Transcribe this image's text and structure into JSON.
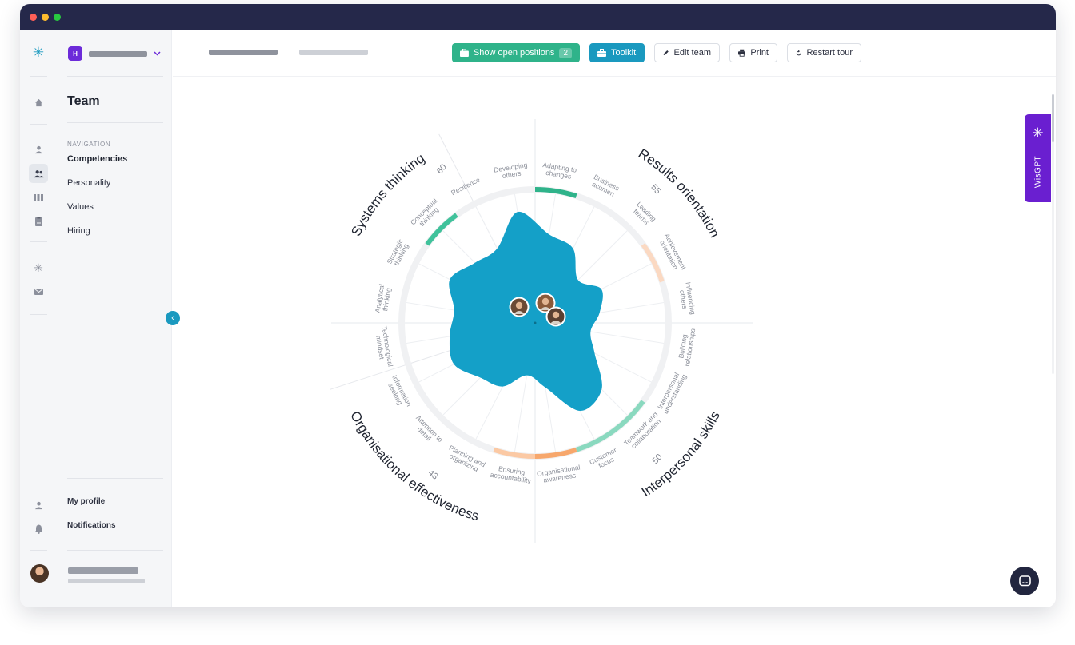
{
  "window": {
    "controls": [
      "close",
      "minimize",
      "maximize"
    ],
    "colors": {
      "close": "#ff5f57",
      "minimize": "#febc2e",
      "maximize": "#28c840"
    }
  },
  "rail": {
    "icons": [
      "snowflake-logo-icon",
      "home-icon",
      "person-icon",
      "team-icon",
      "columns-icon",
      "clipboard-icon",
      "snowflake-icon",
      "mail-icon",
      "person-icon",
      "bell-icon"
    ]
  },
  "sidebar": {
    "workspace_initial": "H",
    "title": "Team",
    "nav_caption": "NAVIGATION",
    "items": [
      {
        "label": "Competencies",
        "active": true
      },
      {
        "label": "Personality",
        "active": false
      },
      {
        "label": "Values",
        "active": false
      },
      {
        "label": "Hiring",
        "active": false
      }
    ],
    "my_profile": "My profile",
    "notifications": "Notifications"
  },
  "toolbar": {
    "show_positions": "Show open positions",
    "positions_count": "2",
    "toolkit": "Toolkit",
    "edit_team": "Edit team",
    "print": "Print",
    "restart_tour": "Restart tour"
  },
  "wisgpt": {
    "label": "WisGPT"
  },
  "colors": {
    "accent_blue": "#1a99bf",
    "accent_green": "#2fb38a",
    "purple": "#6a1fd0",
    "chart_fill": "#0f9ec7",
    "orange": "#f7a76c"
  },
  "chart_data": {
    "type": "radar",
    "groups": [
      {
        "name": "Results orientation",
        "score": "55"
      },
      {
        "name": "Interpersonal skills",
        "score": "50"
      },
      {
        "name": "Organisational effectiveness",
        "score": "43"
      },
      {
        "name": "Systems thinking",
        "score": "60"
      }
    ],
    "axes": [
      {
        "label": "Developing others",
        "value": 0.74
      },
      {
        "label": "Adapting to changes",
        "value": 0.59
      },
      {
        "label": "Business acumen",
        "value": 0.55
      },
      {
        "label": "Leading teams",
        "value": 0.4
      },
      {
        "label": "Achievement orientation",
        "value": 0.49
      },
      {
        "label": "Influencing others",
        "value": 0.43
      },
      {
        "label": "Building relationships",
        "value": 0.37
      },
      {
        "label": "Interpersonal understanding",
        "value": 0.44
      },
      {
        "label": "Teamwork and collaboration",
        "value": 0.62
      },
      {
        "label": "Customer focus",
        "value": 0.65
      },
      {
        "label": "Organisational awareness",
        "value": 0.43
      },
      {
        "label": "Ensuring accountability",
        "value": 0.35
      },
      {
        "label": "Planning and organizing",
        "value": 0.47
      },
      {
        "label": "Attention to detail",
        "value": 0.51
      },
      {
        "label": "Information seeking",
        "value": 0.6
      },
      {
        "label": "Technological mindset",
        "value": 0.57
      },
      {
        "label": "Analytical thinking",
        "value": 0.54
      },
      {
        "label": "Strategic thinking",
        "value": 0.63
      },
      {
        "label": "Conceptual thinking",
        "value": 0.56
      },
      {
        "label": "Resilience",
        "value": 0.55
      }
    ],
    "arc_highlights": [
      {
        "from": "Adapting to changes",
        "to": "Adapting to changes",
        "color": "#2fb38a"
      },
      {
        "from": "Achievement orientation",
        "to": "Achievement orientation",
        "color": "#fbd9c2"
      },
      {
        "from": "Teamwork and collaboration",
        "to": "Customer focus",
        "color": "#8ad9bf"
      },
      {
        "from": "Organisational awareness",
        "to": "Organisational awareness",
        "color": "#f7a76c"
      },
      {
        "from": "Ensuring accountability",
        "to": "Ensuring accountability",
        "color": "#fbc9a4"
      },
      {
        "from": "Conceptual thinking",
        "to": "Conceptual thinking",
        "color": "#40c29b"
      }
    ]
  }
}
